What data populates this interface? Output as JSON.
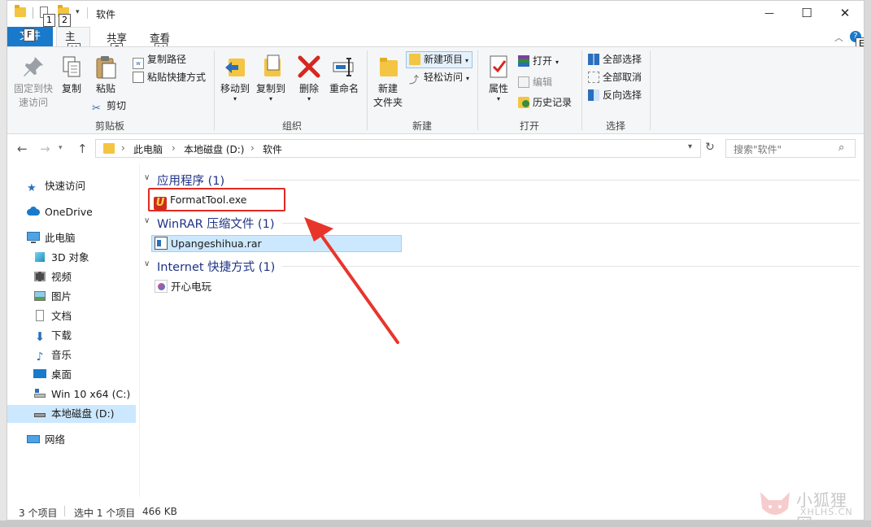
{
  "window": {
    "title": "软件",
    "minimize": "—",
    "maximize": "☐",
    "close": "✕"
  },
  "keytips": {
    "qat1": "1",
    "qat2": "2",
    "file": "F",
    "home": "H",
    "share": "S",
    "view": "V",
    "expand": "E"
  },
  "tabs": [
    {
      "label": "文件",
      "active": false
    },
    {
      "label": "主页",
      "active": true
    },
    {
      "label": "共享",
      "active": false
    },
    {
      "label": "查看",
      "active": false
    }
  ],
  "ribbon": {
    "clipboard": {
      "label": "剪贴板",
      "pin_line1": "固定到快",
      "pin_line2": "速访问",
      "copy": "复制",
      "paste": "粘贴",
      "copy_path": "复制路径",
      "paste_shortcut": "粘贴快捷方式",
      "cut": "剪切"
    },
    "organize": {
      "label": "组织",
      "move_to": "移动到",
      "copy_to": "复制到",
      "delete": "删除",
      "rename": "重命名"
    },
    "new": {
      "label": "新建",
      "new_folder_line1": "新建",
      "new_folder_line2": "文件夹",
      "new_item": "新建项目",
      "easy_access": "轻松访问"
    },
    "open": {
      "label": "打开",
      "properties": "属性",
      "open": "打开",
      "edit": "编辑",
      "history": "历史记录"
    },
    "select": {
      "label": "选择",
      "select_all": "全部选择",
      "select_none": "全部取消",
      "invert": "反向选择"
    }
  },
  "address": {
    "crumbs": [
      "此电脑",
      "本地磁盘 (D:)",
      "软件"
    ],
    "sep": "›",
    "search_placeholder": "搜索\"软件\""
  },
  "navpane": {
    "items": [
      {
        "label": "快速访问",
        "icon": "star-icon"
      },
      {
        "label": "OneDrive",
        "icon": "cloud-icon"
      },
      {
        "label": "此电脑",
        "icon": "computer-icon"
      },
      {
        "label": "3D 对象",
        "icon": "cube-icon"
      },
      {
        "label": "视频",
        "icon": "video-icon"
      },
      {
        "label": "图片",
        "icon": "picture-icon"
      },
      {
        "label": "文档",
        "icon": "document-icon"
      },
      {
        "label": "下载",
        "icon": "download-icon"
      },
      {
        "label": "音乐",
        "icon": "music-icon"
      },
      {
        "label": "桌面",
        "icon": "desktop-icon"
      },
      {
        "label": "Win 10 x64 (C:)",
        "icon": "drive-icon"
      },
      {
        "label": "本地磁盘 (D:)",
        "icon": "drive-icon",
        "selected": true
      },
      {
        "label": "网络",
        "icon": "network-icon"
      }
    ]
  },
  "content": {
    "groups": [
      {
        "header": "应用程序 (1)",
        "files": [
          {
            "name": "FormatTool.exe",
            "icon": "app-u-icon",
            "highlighted": true
          }
        ]
      },
      {
        "header": "WinRAR 压缩文件 (1)",
        "files": [
          {
            "name": "Upangeshihua.rar",
            "icon": "rar-icon",
            "selected": true
          }
        ]
      },
      {
        "header": "Internet 快捷方式 (1)",
        "files": [
          {
            "name": "开心电玩",
            "icon": "url-shortcut-icon"
          }
        ]
      }
    ]
  },
  "status": {
    "count": "3 个项目",
    "selection": "选中 1 个项目",
    "size": "466 KB"
  },
  "watermark": {
    "name": "小狐狸网",
    "domain": "XHLHS.CN"
  },
  "colors": {
    "accent": "#1979ca",
    "selected_bg": "#cce8ff",
    "annotation": "#e02a22",
    "group_header": "#1e3287"
  }
}
